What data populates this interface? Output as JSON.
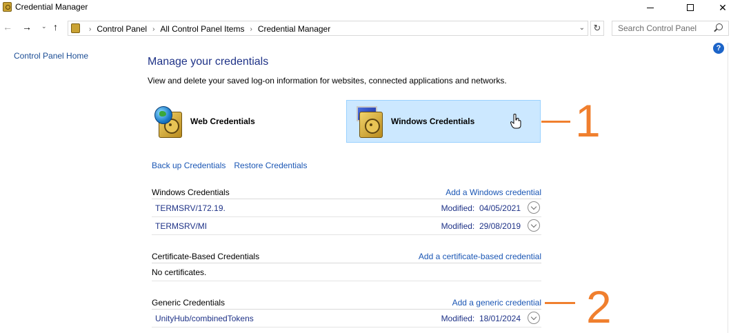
{
  "window": {
    "title": "Credential Manager",
    "icon": "credential-vault-icon"
  },
  "address": {
    "crumbs": [
      "Control Panel",
      "All Control Panel Items",
      "Credential Manager"
    ],
    "search_placeholder": "Search Control Panel"
  },
  "nav": {
    "control_panel_home": "Control Panel Home"
  },
  "help": {
    "label": "?"
  },
  "main": {
    "title": "Manage your credentials",
    "description": "View and delete your saved log-on information for websites, connected applications and networks.",
    "tiles": {
      "web": "Web Credentials",
      "windows": "Windows Credentials"
    },
    "backup_link": "Back up Credentials",
    "restore_link": "Restore Credentials"
  },
  "sections": {
    "windows": {
      "title": "Windows Credentials",
      "action": "Add a Windows credential",
      "items": [
        {
          "name": "TERMSRV/172.19.",
          "modified_label": "Modified:",
          "modified": "04/05/2021"
        },
        {
          "name": "TERMSRV/MI",
          "modified_label": "Modified:",
          "modified": "29/08/2019"
        }
      ]
    },
    "certificate": {
      "title": "Certificate-Based Credentials",
      "action": "Add a certificate-based credential",
      "empty": "No certificates."
    },
    "generic": {
      "title": "Generic Credentials",
      "action": "Add a generic credential",
      "items": [
        {
          "name": "UnityHub/combinedTokens",
          "modified_label": "Modified:",
          "modified": "18/01/2024"
        }
      ]
    }
  },
  "annotations": [
    "1",
    "2"
  ],
  "colors": {
    "accent": "#f07f2e",
    "selected_tile": "#cce8ff",
    "link": "#1a56b4"
  }
}
